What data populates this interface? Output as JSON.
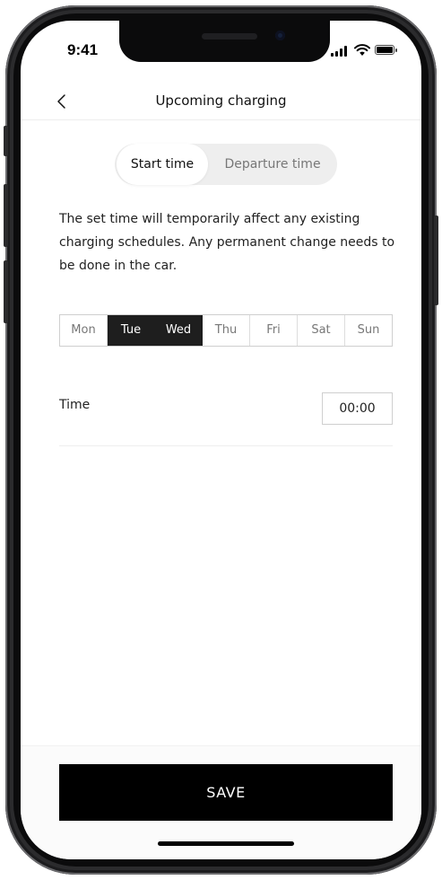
{
  "status_bar": {
    "time": "9:41"
  },
  "header": {
    "title": "Upcoming charging"
  },
  "segment": {
    "start_time": "Start time",
    "departure_time": "Departure time",
    "selected": "Start time"
  },
  "info_text": "The set time will temporarily affect any existing charging schedules. Any permanent change needs to be done in the car.",
  "days": [
    {
      "label": "Mon",
      "selected": false
    },
    {
      "label": "Tue",
      "selected": true
    },
    {
      "label": "Wed",
      "selected": true
    },
    {
      "label": "Thu",
      "selected": false
    },
    {
      "label": "Fri",
      "selected": false
    },
    {
      "label": "Sat",
      "selected": false
    },
    {
      "label": "Sun",
      "selected": false
    }
  ],
  "time_row": {
    "label": "Time",
    "value": "00:00"
  },
  "save_label": "SAVE",
  "colors": {
    "selected_day_bg": "#1e1e1e",
    "save_bg": "#000000",
    "segment_bg": "#eeeeee"
  },
  "icons": {
    "back": "chevron-left-icon",
    "signal": "signal-icon",
    "wifi": "wifi-icon",
    "battery": "battery-icon"
  }
}
